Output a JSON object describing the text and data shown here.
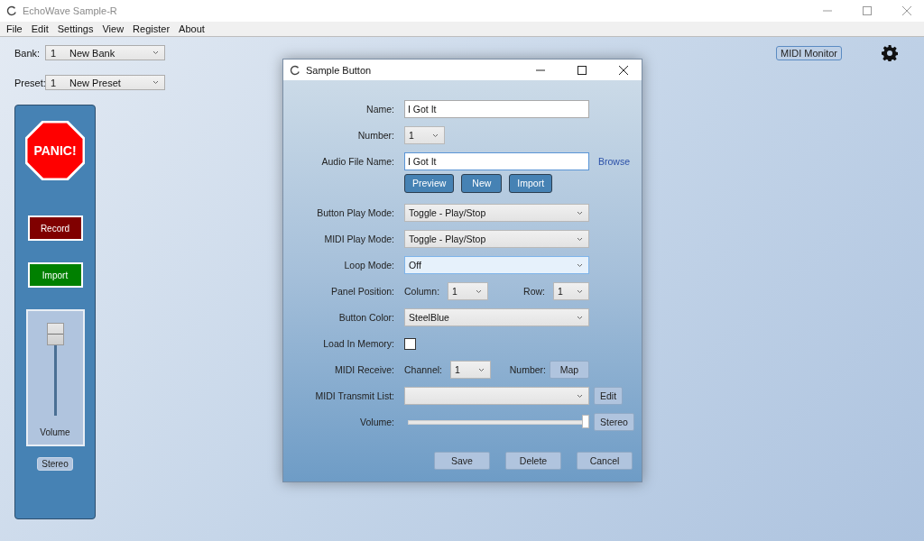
{
  "window": {
    "title": "EchoWave Sample-R"
  },
  "menu": [
    "File",
    "Edit",
    "Settings",
    "View",
    "Register",
    "About"
  ],
  "bank": {
    "label": "Bank:",
    "number": "1",
    "value": "New Bank"
  },
  "preset": {
    "label": "Preset:",
    "number": "1",
    "value": "New Preset"
  },
  "midi_monitor_button": "MIDI Monitor",
  "side_panel": {
    "panic": "PANIC!",
    "buttons": [
      {
        "label": "Record",
        "color": "#800000"
      },
      {
        "label": "Import",
        "color": "#008000"
      }
    ],
    "volume": {
      "label": "Volume",
      "level": 1.0
    },
    "stereo_button": "Stereo"
  },
  "dialog": {
    "title": "Sample Button",
    "rows": [
      {
        "kind": "text",
        "label": "Name:",
        "value": "I Got It",
        "focused": false
      },
      {
        "kind": "select",
        "label": "Number:",
        "value": "1",
        "small": true,
        "focused": false
      },
      {
        "kind": "text",
        "label": "Audio File Name:",
        "value": "I Got It",
        "focused": true,
        "link": "Browse"
      },
      {
        "kind": "buttons",
        "buttons": [
          "Preview",
          "New",
          "Import"
        ]
      },
      {
        "kind": "select",
        "label": "Button Play Mode:",
        "value": "Toggle - Play/Stop",
        "focused": false
      },
      {
        "kind": "select",
        "label": "MIDI Play Mode:",
        "value": "Toggle - Play/Stop",
        "focused": false
      },
      {
        "kind": "select",
        "label": "Loop Mode:",
        "value": "Off",
        "focused": true
      },
      {
        "kind": "position",
        "label": "Panel Position:",
        "column_label": "Column:",
        "column": "1",
        "row_label": "Row:",
        "row": "1"
      },
      {
        "kind": "select",
        "label": "Button Color:",
        "value": "SteelBlue",
        "focused": false
      },
      {
        "kind": "checkbox",
        "label": "Load In Memory:",
        "checked": false
      },
      {
        "kind": "midi",
        "label": "MIDI Receive:",
        "channel_label": "Channel:",
        "channel": "1",
        "number_label": "Number:",
        "button": "Map"
      },
      {
        "kind": "select",
        "label": "MIDI Transmit List:",
        "focused": false,
        "button": "Edit"
      },
      {
        "kind": "slider",
        "label": "Volume:",
        "level": 1.0,
        "button": "Stereo"
      }
    ],
    "footer_buttons": [
      "Save",
      "Delete",
      "Cancel"
    ]
  }
}
